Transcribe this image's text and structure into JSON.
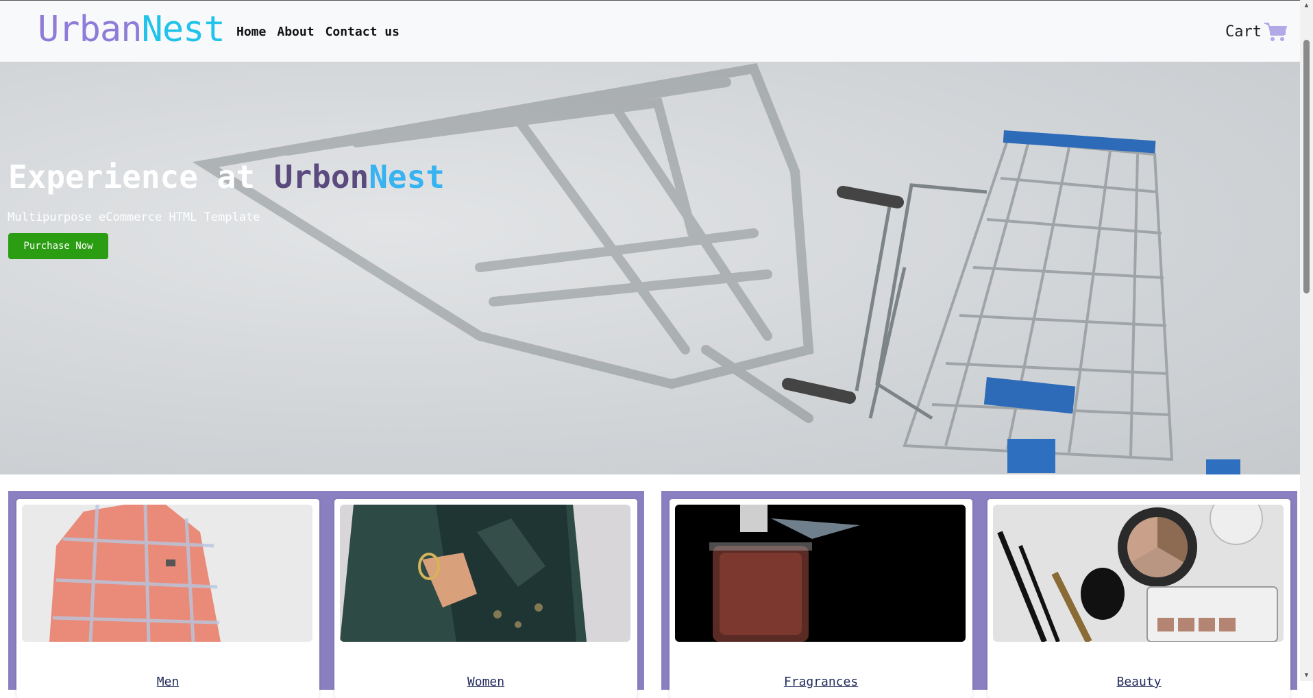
{
  "navbar": {
    "brand_part1": "Urban",
    "brand_part2": "Nest",
    "links": [
      "Home",
      "About",
      "Contact us"
    ],
    "cart_label": "Cart",
    "cart_icon": "shopping-cart-icon",
    "brand_color_1": "#8e7cd8",
    "brand_color_2": "#22c3ea"
  },
  "hero": {
    "title_prefix": "Experience at ",
    "title_brand_1": "Urbon",
    "title_brand_2": "Nest",
    "subtitle": "Multipurpose eCommerce HTML Template",
    "button_label": "Purchase Now",
    "button_color": "#2a9d12"
  },
  "categories": [
    {
      "title": "Men"
    },
    {
      "title": "Women"
    },
    {
      "title": "Fragrances"
    },
    {
      "title": "Beauty"
    }
  ],
  "colors": {
    "section_bg": "#8a7fc0",
    "category_title": "#1f2a5a"
  }
}
